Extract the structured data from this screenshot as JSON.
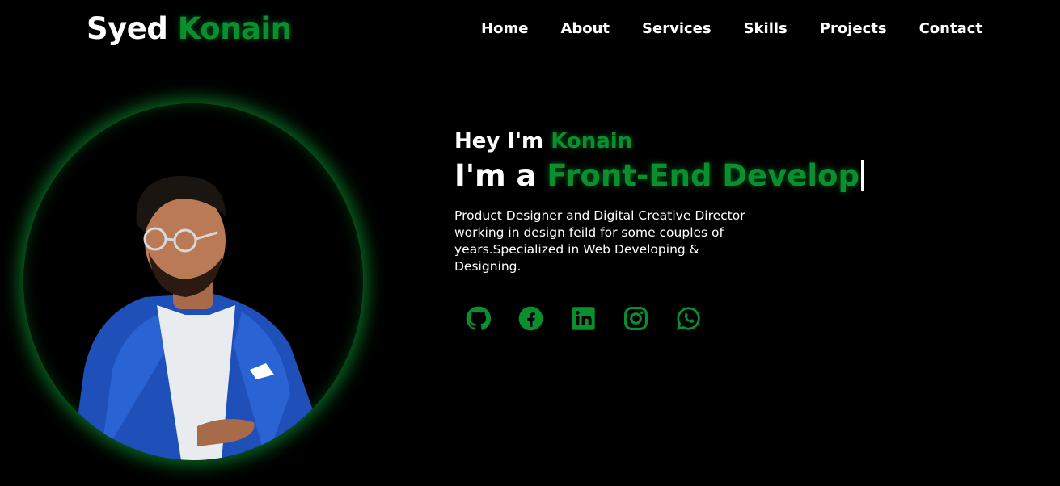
{
  "brand": {
    "first": "Syed",
    "second": "Konain"
  },
  "nav": [
    "Home",
    "About",
    "Services",
    "Skills",
    "Projects",
    "Contact"
  ],
  "hero": {
    "greeting_prefix": "Hey I'm",
    "greeting_name": "Konain",
    "role_prefix": "I'm a",
    "role_typed": "Front-End Develop",
    "description": "Product Designer and Digital Creative Director working in design feild for some couples of years.Specialized in Web Developing & Designing."
  },
  "socials": [
    "github-icon",
    "facebook-icon",
    "linkedin-icon",
    "instagram-icon",
    "whatsapp-icon"
  ],
  "colors": {
    "background": "#000000",
    "accent": "#0a8f2f",
    "text": "#ffffff"
  }
}
